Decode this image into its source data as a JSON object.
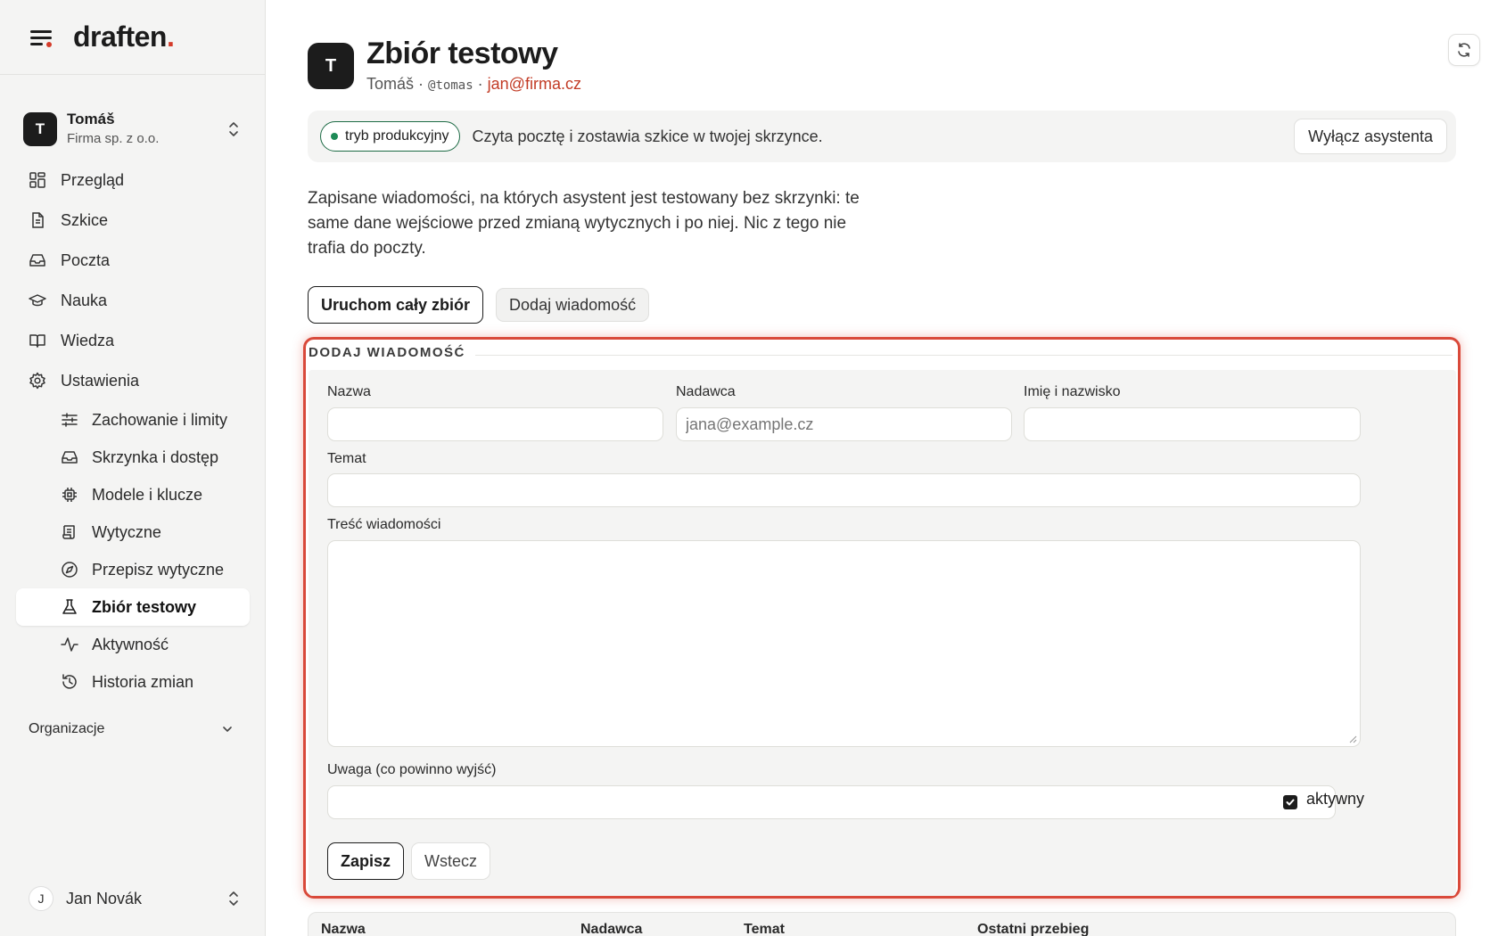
{
  "brand": {
    "name": "draften",
    "dot": "."
  },
  "account": {
    "initial": "T",
    "name": "Tomáš",
    "org": "Firma sp. z o.o."
  },
  "nav": {
    "items": [
      {
        "label": "Przegląd",
        "icon": "grid-icon"
      },
      {
        "label": "Szkice",
        "icon": "document-icon"
      },
      {
        "label": "Poczta",
        "icon": "inbox-icon"
      },
      {
        "label": "Nauka",
        "icon": "graduation-cap-icon"
      },
      {
        "label": "Wiedza",
        "icon": "book-icon"
      },
      {
        "label": "Ustawienia",
        "icon": "gear-icon"
      }
    ],
    "subitems": [
      {
        "label": "Zachowanie i limity",
        "icon": "sliders-icon"
      },
      {
        "label": "Skrzynka i dostęp",
        "icon": "inbox-icon"
      },
      {
        "label": "Modele i klucze",
        "icon": "chip-icon"
      },
      {
        "label": "Wytyczne",
        "icon": "scroll-icon"
      },
      {
        "label": "Przepisz wytyczne",
        "icon": "compass-icon"
      },
      {
        "label": "Zbiór testowy",
        "icon": "flask-icon",
        "active": true
      },
      {
        "label": "Aktywność",
        "icon": "activity-icon"
      },
      {
        "label": "Historia zmian",
        "icon": "history-icon"
      }
    ],
    "org_label": "Organizacje"
  },
  "user": {
    "initial": "J",
    "name": "Jan Novák"
  },
  "header": {
    "initial": "T",
    "title": "Zbiór testowy",
    "owner": "Tomáš",
    "sep": "·",
    "handle": "@tomas",
    "email": "jan@firma.cz"
  },
  "banner": {
    "badge": "tryb produkcyjny",
    "text": "Czyta pocztę i zostawia szkice w twojej skrzynce.",
    "button": "Wyłącz asystenta"
  },
  "intro": "Zapisane wiadomości, na których asystent jest testowany bez skrzynki: te same dane wejściowe przed zmianą wytycznych i po niej. Nic z tego nie trafia do poczty.",
  "actions": {
    "run_all": "Uruchom cały zbiór",
    "add_message": "Dodaj wiadomość"
  },
  "form": {
    "legend": "DODAJ WIADOMOŚĆ",
    "name_label": "Nazwa",
    "name_value": "",
    "sender_label": "Nadawca",
    "sender_placeholder": "jana@example.cz",
    "fullname_label": "Imię i nazwisko",
    "fullname_value": "",
    "subject_label": "Temat",
    "subject_value": "",
    "body_label": "Treść wiadomości",
    "note_label": "Uwaga (co powinno wyjść)",
    "note_value": "",
    "active_label": "aktywny",
    "active_checked": true,
    "save": "Zapisz",
    "back": "Wstecz"
  },
  "table": {
    "columns": [
      "Nazwa",
      "Nadawca",
      "Temat",
      "Ostatni przebieg"
    ]
  },
  "colors": {
    "accent": "#d43b2a",
    "link": "#c23b25",
    "status_green": "#1d8a56",
    "highlight": "#d9493a"
  }
}
